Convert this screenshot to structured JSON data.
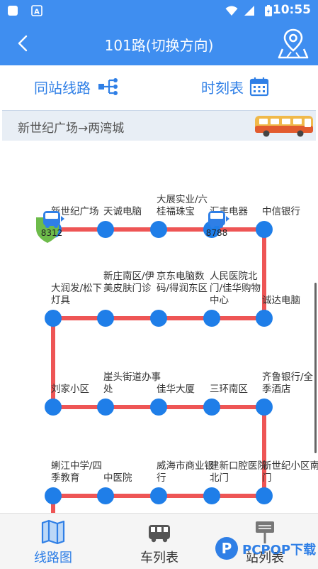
{
  "status": {
    "time": "10:55"
  },
  "header": {
    "title": "101路(切换方向)"
  },
  "top_tabs": {
    "same_station": "同站线路",
    "timetable": "时刻表"
  },
  "direction": {
    "text": "新世纪广场→两湾城"
  },
  "colors": {
    "primary": "#3f8ef0",
    "route_line": "#ee5555",
    "stop_dot": "#1f7ee8",
    "marker_green": "#6dbb4a"
  },
  "route": {
    "stops": [
      {
        "name": "新世纪广场"
      },
      {
        "name": "天诚电脑"
      },
      {
        "name": "大展实业/六桂福珠宝"
      },
      {
        "name": "汇丰电器"
      },
      {
        "name": "中信银行"
      },
      {
        "name": "诚达电脑"
      },
      {
        "name": "人民医院北门/佳华购物中心"
      },
      {
        "name": "京东电脑数码/得润东区"
      },
      {
        "name": "新庄南区/伊美皮肤门诊"
      },
      {
        "name": "大润发/松下灯具"
      },
      {
        "name": "刘家小区"
      },
      {
        "name": "崖头街道办事处"
      },
      {
        "name": "佳华大厦"
      },
      {
        "name": "三环南区"
      },
      {
        "name": "齐鲁银行/全季酒店"
      },
      {
        "name": "新世纪小区南门"
      },
      {
        "name": "建新口腔医院北门"
      },
      {
        "name": "威海市商业银行"
      },
      {
        "name": "中医院"
      },
      {
        "name": "蜊江中学/四季教育"
      }
    ],
    "buses": [
      {
        "plate": "8312"
      },
      {
        "plate": "8788"
      }
    ]
  },
  "bottom_nav": {
    "route_map": "线路图",
    "bus_list": "车列表",
    "station_list": "站列表"
  },
  "watermark": {
    "text": "PCPOP下载"
  }
}
